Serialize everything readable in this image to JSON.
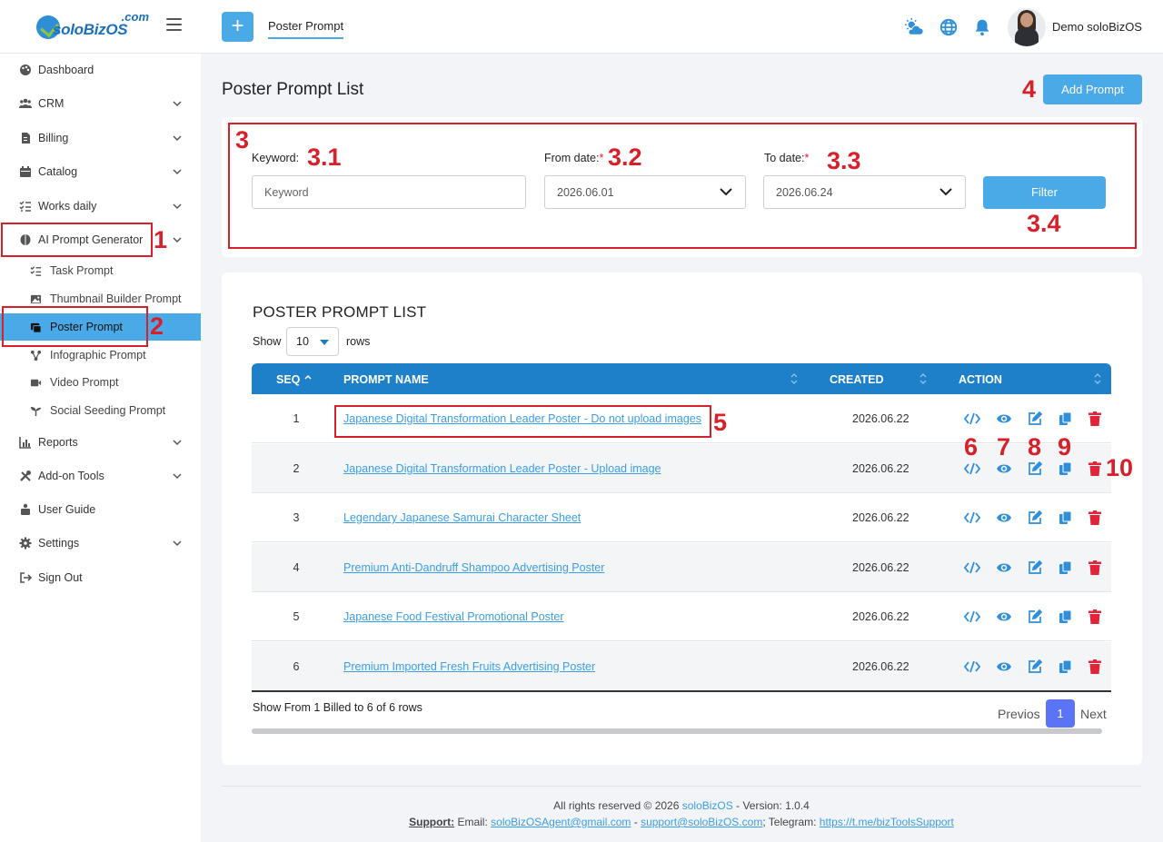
{
  "header": {
    "logo_com": ".com",
    "logo_word": "soloBizOS",
    "active_tab": "Poster Prompt",
    "plus_label": "+",
    "user_name": "Demo soloBizOS"
  },
  "sidebar": {
    "items": [
      {
        "label": "Dashboard",
        "icon": "palette-icon"
      },
      {
        "label": "CRM",
        "icon": "users-icon"
      },
      {
        "label": "Billing",
        "icon": "file-invoice-icon"
      },
      {
        "label": "Catalog",
        "icon": "calendar-icon"
      },
      {
        "label": "Works daily",
        "icon": "checklist-icon"
      },
      {
        "label": "AI Prompt Generator",
        "icon": "brain-icon"
      },
      {
        "label": "Reports",
        "icon": "chart-icon"
      },
      {
        "label": "Add-on Tools",
        "icon": "tools-icon"
      },
      {
        "label": "User Guide",
        "icon": "guide-icon"
      },
      {
        "label": "Settings",
        "icon": "gear-icon"
      },
      {
        "label": "Sign Out",
        "icon": "sign-out-icon"
      }
    ],
    "subitems": [
      {
        "label": "Task Prompt"
      },
      {
        "label": "Thumbnail Builder Prompt"
      },
      {
        "label": "Poster Prompt"
      },
      {
        "label": "Infographic Prompt"
      },
      {
        "label": "Video Prompt"
      },
      {
        "label": "Social Seeding Prompt"
      }
    ]
  },
  "page": {
    "title": "Poster Prompt List",
    "add_button": "Add Prompt"
  },
  "filter": {
    "keyword_label": "Keyword:",
    "keyword_placeholder": "Keyword",
    "from_label": "From date:",
    "from_value": "2026.06.01",
    "to_label": "To date:",
    "to_value": "2026.06.24",
    "required_mark": "*",
    "button": "Filter"
  },
  "list": {
    "title": "POSTER PROMPT LIST",
    "show_label": "Show",
    "rows_value": "10",
    "rows_label": "rows",
    "columns": [
      "SEQ",
      "PROMPT NAME",
      "CREATED",
      "ACTION"
    ],
    "rows": [
      {
        "seq": "1",
        "name": "Japanese Digital Transformation Leader Poster - Do not upload images",
        "created": "2026.06.22"
      },
      {
        "seq": "2",
        "name": "Japanese Digital Transformation Leader Poster - Upload image",
        "created": "2026.06.22"
      },
      {
        "seq": "3",
        "name": "Legendary Japanese Samurai Character Sheet",
        "created": "2026.06.22"
      },
      {
        "seq": "4",
        "name": "Premium Anti-Dandruff Shampoo Advertising Poster",
        "created": "2026.06.22"
      },
      {
        "seq": "5",
        "name": "Japanese Food Festival Promotional Poster",
        "created": "2026.06.22"
      },
      {
        "seq": "6",
        "name": "Premium Imported Fresh Fruits Advertising Poster",
        "created": "2026.06.22"
      }
    ],
    "summary": "Show From 1 Billed to 6 of 6 rows",
    "prev": "Previos",
    "page": "1",
    "next": "Next"
  },
  "annotations": [
    "1",
    "2",
    "3",
    "3.1",
    "3.2",
    "3.3",
    "3.4",
    "4",
    "5",
    "6",
    "7",
    "8",
    "9",
    "10"
  ],
  "footer": {
    "copyright": "All rights reserved © 2026",
    "brand": "soloBizOS",
    "version": "- Version: 1.0.4",
    "support_label": "Support:",
    "email_label": "Email:",
    "email1": "soloBizOSAgent@gmail.com",
    "sep": "-",
    "email2": "support@soloBizOS.com",
    "telegram_label": "; Telegram:",
    "telegram": "https://t.me/bizToolsSupport"
  },
  "colors": {
    "accent": "#4aaae8",
    "table_header": "#1e80c8",
    "annotation": "#d8202a",
    "delete": "#e0243a",
    "pager_active": "#5b73f5"
  }
}
